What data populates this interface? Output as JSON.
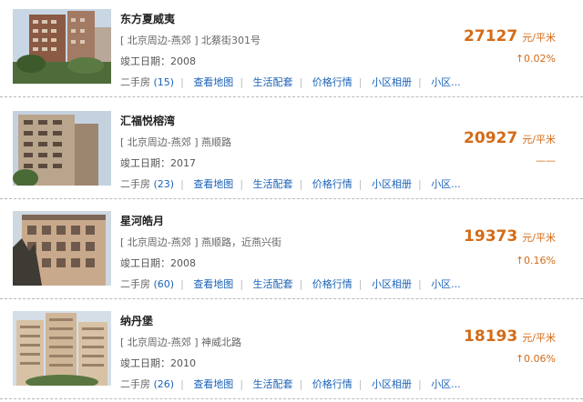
{
  "listings": [
    {
      "name": "东方夏威夷",
      "address": "[ 北京周边-燕郊 ] 北蔡街301号",
      "completion": "竣工日期：2008",
      "secondhand_label": "二手房",
      "secondhand_count": "(15)",
      "price": "27127",
      "unit": "元/平米",
      "change": "↑0.02%"
    },
    {
      "name": "汇福悦榕湾",
      "address": "[ 北京周边-燕郊 ] 燕顺路",
      "completion": "竣工日期：2017",
      "secondhand_label": "二手房",
      "secondhand_count": "(23)",
      "price": "20927",
      "unit": "元/平米",
      "change": "——"
    },
    {
      "name": "星河皓月",
      "address": "[ 北京周边-燕郊 ] 燕顺路，近燕兴街",
      "completion": "竣工日期：2008",
      "secondhand_label": "二手房",
      "secondhand_count": "(60)",
      "price": "19373",
      "unit": "元/平米",
      "change": "↑0.16%"
    },
    {
      "name": "纳丹堡",
      "address": "[ 北京周边-燕郊 ] 神威北路",
      "completion": "竣工日期：2010",
      "secondhand_label": "二手房",
      "secondhand_count": "(26)",
      "price": "18193",
      "unit": "元/平米",
      "change": "↑0.06%"
    }
  ],
  "links": {
    "map": "查看地图",
    "facilities": "生活配套",
    "prices": "价格行情",
    "album": "小区相册",
    "more": "小区..."
  },
  "colors": {
    "price": "#d46b17",
    "link": "#1a62b7",
    "separator": "#b8b8b8"
  }
}
